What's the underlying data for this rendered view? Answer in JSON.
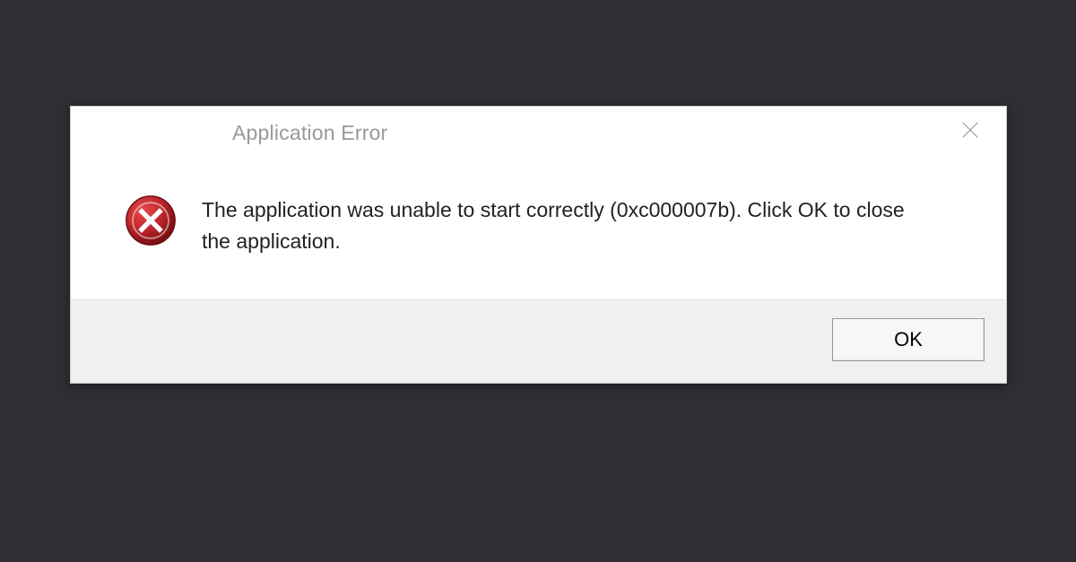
{
  "dialog": {
    "title": "Application Error",
    "message": "The application was unable to start correctly (0xc000007b). Click OK to close the application.",
    "ok_label": "OK"
  },
  "icons": {
    "error": "error-icon",
    "close": "close-icon"
  },
  "colors": {
    "error_red": "#c0272d",
    "background_dark": "#2f2f33",
    "footer_gray": "#f0f0f0"
  }
}
